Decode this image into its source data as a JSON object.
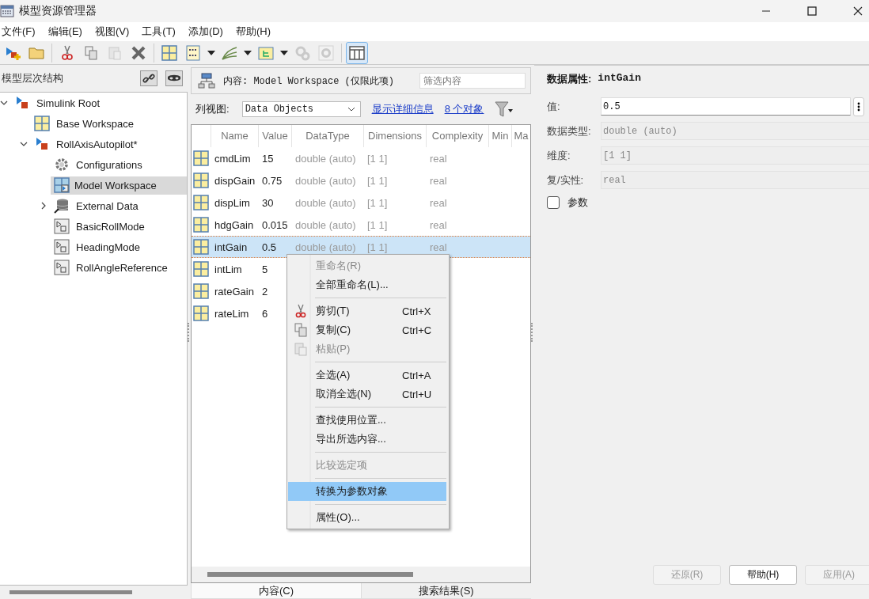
{
  "window": {
    "title": "模型资源管理器"
  },
  "menu_bar": [
    "文件(F)",
    "编辑(E)",
    "视图(V)",
    "工具(T)",
    "添加(D)",
    "帮助(H)"
  ],
  "toolbar": [
    {
      "kind": "new-model",
      "disabled": false,
      "pressed": false
    },
    {
      "kind": "folder",
      "disabled": false,
      "pressed": false
    },
    {
      "kind": "separator"
    },
    {
      "kind": "cut",
      "disabled": false,
      "pressed": false
    },
    {
      "kind": "copy",
      "disabled": false,
      "pressed": false
    },
    {
      "kind": "paste",
      "disabled": true,
      "pressed": false
    },
    {
      "kind": "delete",
      "disabled": false,
      "pressed": false
    },
    {
      "kind": "separator"
    },
    {
      "kind": "grid",
      "disabled": false,
      "pressed": false
    },
    {
      "kind": "binary",
      "disabled": false,
      "pressed": false
    },
    {
      "kind": "caret"
    },
    {
      "kind": "curves",
      "disabled": false,
      "pressed": false
    },
    {
      "kind": "caret"
    },
    {
      "kind": "tree-box",
      "disabled": false,
      "pressed": false
    },
    {
      "kind": "caret"
    },
    {
      "kind": "gears",
      "disabled": true,
      "pressed": false
    },
    {
      "kind": "gear",
      "disabled": true,
      "pressed": false
    },
    {
      "kind": "separator"
    },
    {
      "kind": "columns",
      "disabled": false,
      "pressed": true
    }
  ],
  "hierarchy": {
    "title": "模型层次结构",
    "tree": [
      {
        "label": "Simulink Root",
        "kind": "model",
        "selected": false,
        "expanded": true,
        "children": [
          {
            "label": "Base Workspace",
            "kind": "workspace",
            "selected": false
          },
          {
            "label": "RollAxisAutopilot*",
            "kind": "model",
            "selected": false,
            "expanded": true,
            "children": [
              {
                "label": "Configurations",
                "kind": "config",
                "selected": false
              },
              {
                "label": "Model Workspace",
                "kind": "model-workspace",
                "selected": true
              },
              {
                "label": "External Data",
                "kind": "database",
                "selected": false,
                "expanded": false
              },
              {
                "label": "BasicRollMode",
                "kind": "subsystem",
                "selected": false
              },
              {
                "label": "HeadingMode",
                "kind": "subsystem",
                "selected": false
              },
              {
                "label": "RollAngleReference",
                "kind": "subsystem",
                "selected": false
              }
            ]
          }
        ]
      }
    ]
  },
  "contents": {
    "header": "内容: Model Workspace (仅限此项)",
    "filter": {
      "placeholder": "筛选内容"
    },
    "column_view_label": "列视图:",
    "column_view": "Data Objects",
    "details_link": "显示详细信息",
    "count_link": "8 个对象",
    "table": {
      "columns": [
        "Name",
        "Value",
        "DataType",
        "Dimensions",
        "Complexity",
        "Min",
        "Ma"
      ],
      "rows": [
        {
          "cells": [
            "cmdLim",
            "15",
            "double (auto)",
            "[1 1]",
            "real"
          ],
          "selected": false
        },
        {
          "cells": [
            "dispGain",
            "0.75",
            "double (auto)",
            "[1 1]",
            "real"
          ],
          "selected": false
        },
        {
          "cells": [
            "dispLim",
            "30",
            "double (auto)",
            "[1 1]",
            "real"
          ],
          "selected": false
        },
        {
          "cells": [
            "hdgGain",
            "0.015",
            "double (auto)",
            "[1 1]",
            "real"
          ],
          "selected": false
        },
        {
          "cells": [
            "intGain",
            "0.5",
            "double (auto)",
            "[1 1]",
            "real"
          ],
          "selected": true
        },
        {
          "cells": [
            "intLim",
            "5"
          ],
          "selected": false
        },
        {
          "cells": [
            "rateGain",
            "2"
          ],
          "selected": false
        },
        {
          "cells": [
            "rateLim",
            "6"
          ],
          "selected": false
        }
      ]
    },
    "tabs": [
      {
        "label": "内容(C)",
        "selected": true
      },
      {
        "label": "搜索结果(S)",
        "selected": false
      }
    ]
  },
  "context_menu": [
    {
      "kind": "item",
      "label": "重命名(R)",
      "disabled": true,
      "selected": false
    },
    {
      "kind": "item",
      "label": "全部重命名(L)...",
      "disabled": false,
      "selected": false
    },
    {
      "kind": "separator"
    },
    {
      "kind": "cut",
      "label": "剪切(T)",
      "shortcut": "Ctrl+X",
      "disabled": false,
      "selected": false
    },
    {
      "kind": "copy",
      "label": "复制(C)",
      "shortcut": "Ctrl+C",
      "disabled": false,
      "selected": false
    },
    {
      "kind": "paste",
      "label": "粘贴(P)",
      "disabled": true,
      "selected": false
    },
    {
      "kind": "separator"
    },
    {
      "kind": "item",
      "label": "全选(A)",
      "shortcut": "Ctrl+A",
      "disabled": false,
      "selected": false
    },
    {
      "kind": "item",
      "label": "取消全选(N)",
      "shortcut": "Ctrl+U",
      "disabled": false,
      "selected": false
    },
    {
      "kind": "separator"
    },
    {
      "kind": "item",
      "label": "查找使用位置...",
      "disabled": false,
      "selected": false
    },
    {
      "kind": "item",
      "label": "导出所选内容...",
      "disabled": false,
      "selected": false
    },
    {
      "kind": "separator"
    },
    {
      "kind": "item",
      "label": "比较选定项",
      "disabled": true,
      "selected": false
    },
    {
      "kind": "separator"
    },
    {
      "kind": "item",
      "label": "转换为参数对象",
      "disabled": false,
      "selected": true
    },
    {
      "kind": "separator"
    },
    {
      "kind": "item",
      "label": "属性(O)...",
      "disabled": false,
      "selected": false
    }
  ],
  "properties": {
    "title_label": "数据属性:",
    "title_name": "intGain",
    "fields": [
      {
        "label": "值:",
        "value": "0.5",
        "disabled": false
      },
      {
        "label": "数据类型:",
        "value": "double (auto)",
        "disabled": true
      },
      {
        "label": "维度:",
        "value": "[1 1]",
        "disabled": true
      },
      {
        "label": "复/实性:",
        "value": "real",
        "disabled": true
      }
    ],
    "parameter": {
      "label": "参数",
      "checked": false
    },
    "buttons": [
      {
        "label": "还原(R)",
        "disabled": true
      },
      {
        "label": "帮助(H)",
        "disabled": false
      },
      {
        "label": "应用(A)",
        "disabled": true
      }
    ]
  }
}
